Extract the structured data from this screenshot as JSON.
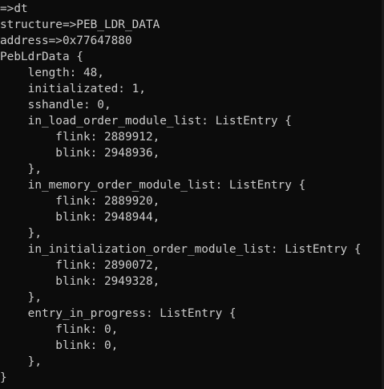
{
  "terminal": {
    "background_color": "#0c0c0c",
    "text_color": "#cccccc",
    "lines": [
      "=>dt",
      "structure=>PEB_LDR_DATA",
      "address=>0x77647880",
      "PebLdrData {",
      "    length: 48,",
      "    initializated: 1,",
      "    sshandle: 0,",
      "    in_load_order_module_list: ListEntry {",
      "        flink: 2889912,",
      "        blink: 2948936,",
      "    },",
      "    in_memory_order_module_list: ListEntry {",
      "        flink: 2889920,",
      "        blink: 2948944,",
      "    },",
      "    in_initialization_order_module_list: ListEntry {",
      "        flink: 2890072,",
      "        blink: 2949328,",
      "    },",
      "    entry_in_progress: ListEntry {",
      "        flink: 0,",
      "        blink: 0,",
      "    },",
      "}"
    ]
  }
}
